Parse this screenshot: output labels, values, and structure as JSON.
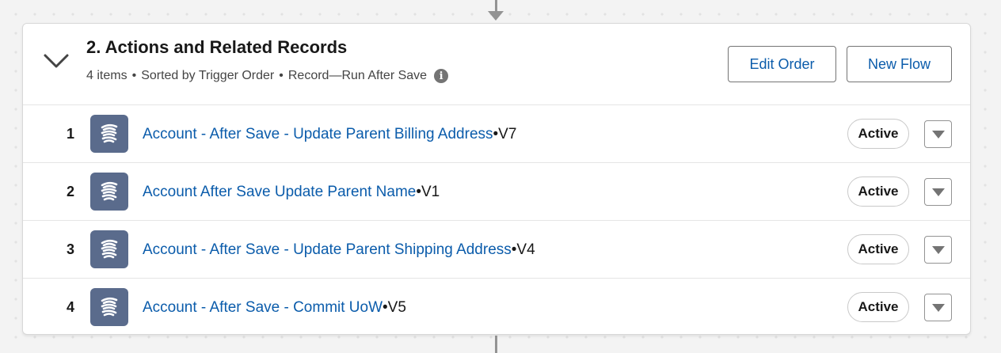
{
  "section": {
    "title": "2. Actions and Related Records",
    "meta": {
      "items": "4 items",
      "bullet1": "•",
      "sort": "Sorted by Trigger Order",
      "bullet2": "•",
      "mode": "Record—Run After Save",
      "info_glyph": "i"
    },
    "buttons": {
      "edit_order": "Edit Order",
      "new_flow": "New Flow"
    }
  },
  "rows": [
    {
      "num": "1",
      "name": "Account - After Save - Update Parent Billing Address",
      "version": "•V7",
      "status": "Active"
    },
    {
      "num": "2",
      "name": "Account After Save Update Parent Name",
      "version": "•V1",
      "status": "Active"
    },
    {
      "num": "3",
      "name": "Account - After Save - Update Parent Shipping Address",
      "version": "•V4",
      "status": "Active"
    },
    {
      "num": "4",
      "name": "Account - After Save - Commit UoW",
      "version": "•V5",
      "status": "Active"
    }
  ],
  "icons": {
    "toggle": "chevron-down-icon",
    "info": "info-icon",
    "flow": "flow-icon",
    "row_menu": "caret-down-icon"
  },
  "colors": {
    "link": "#0b5cab",
    "flow_icon_bg": "#5a6b8c",
    "connector": "#939393"
  }
}
